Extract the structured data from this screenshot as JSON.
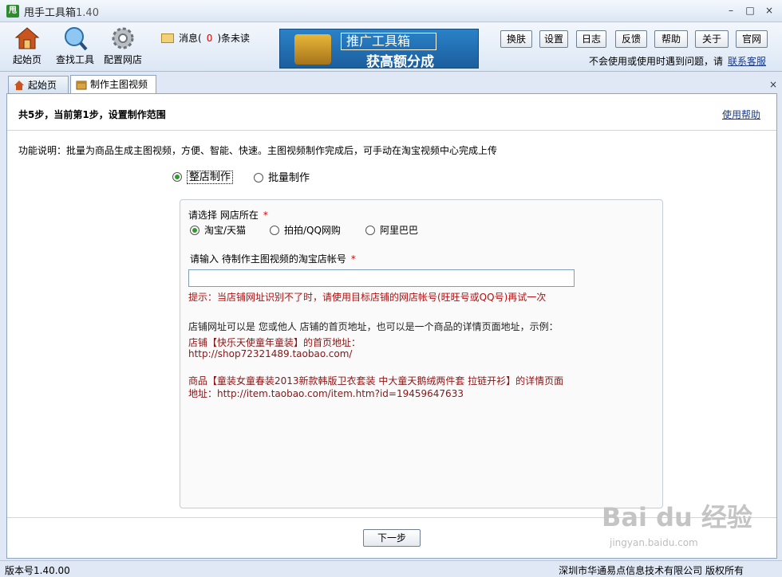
{
  "window": {
    "app_name": "甩手工具箱",
    "version": "1.40",
    "minimize": "–",
    "maximize": "□",
    "close": "×"
  },
  "toolbar": {
    "home": "起始页",
    "find_tools": "查找工具",
    "config_shop": "配置网店",
    "msg_prefix": "消息(",
    "msg_count": "0",
    "msg_suffix": ")条未读",
    "banner_line1": "推广工具箱",
    "banner_line2": "获高额分成",
    "buttons": [
      "换肤",
      "设置",
      "日志",
      "反馈",
      "帮助",
      "关于",
      "官网"
    ],
    "support_text": "不会使用或使用时遇到问题，请",
    "support_link": "联系客服"
  },
  "tabs": [
    {
      "label": "起始页"
    },
    {
      "label": "制作主图视频"
    }
  ],
  "step": {
    "header": "共5步，当前第1步，设置制作范围",
    "help_link": "使用帮助",
    "description": "功能说明：批量为商品生成主图视频，方便、智能、快速。主图视频制作完成后，可手动在淘宝视频中心完成上传",
    "mode_whole_shop": "整店制作",
    "mode_batch": "批量制作"
  },
  "panel": {
    "choose_shop_label": "请选择 网店所在",
    "required": "*",
    "platforms": [
      "淘宝/天猫",
      "拍拍/QQ网购",
      "阿里巴巴"
    ],
    "account_label": "请输入 待制作主图视频的淘宝店帐号",
    "account_value": "",
    "tip": "提示：当店铺网址识别不了时，请使用目标店铺的网店帐号(旺旺号或QQ号)再试一次",
    "address_intro": "店铺网址可以是 您或他人 店铺的首页地址，也可以是一个商品的详情页面地址，示例：",
    "example1_title": "店铺【快乐天使童年童装】的首页地址：",
    "example1_url": "http://shop72321489.taobao.com/",
    "example2_title": "商品【童装女童春装2013新款韩版卫衣套装 中大童天鹅绒两件套 拉链开衫】的详情页面",
    "example2_url": "地址：http://item.taobao.com/item.htm?id=19459647633"
  },
  "next_button": "下一步",
  "status": {
    "version": "版本号1.40.00",
    "copyright": "深圳市华通易点信息技术有限公司  版权所有"
  },
  "watermark": {
    "brand": "Bai du 经验",
    "url": "jingyan.baidu.com"
  }
}
